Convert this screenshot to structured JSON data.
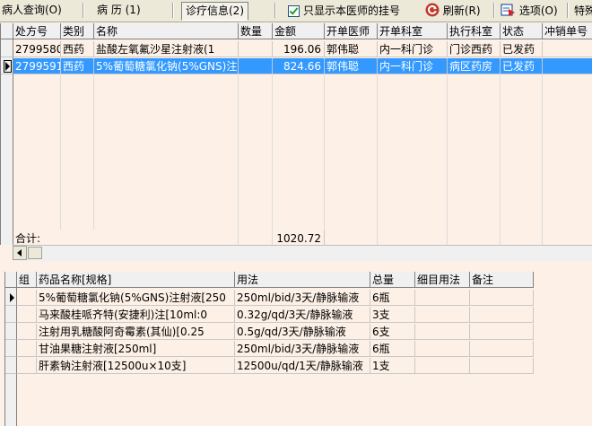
{
  "toolbar": {
    "tab_patient_query": "病人查询(O)",
    "tab_history": "病  历 (1)",
    "tab_diagnosis": "诊疗信息(2)",
    "checkbox_label": "只显示本医师的挂号",
    "checkbox_checked": true,
    "refresh_label": "刷新(R)",
    "options_label": "选项(O)",
    "special_label": "特殊"
  },
  "orders": {
    "columns": [
      "处方号",
      "类别",
      "名称",
      "数量",
      "金额",
      "开单医师",
      "开单科室",
      "执行科室",
      "状态",
      "冲销单号"
    ],
    "rows": [
      [
        "2799580",
        "西药",
        "盐酸左氧氟沙星注射液(1",
        "",
        "196.06",
        "郭伟聪",
        "内一科门诊",
        "门诊西药",
        "已发药",
        ""
      ],
      [
        "2799591",
        "西药",
        "5%葡萄糖氯化钠(5%GNS)注",
        "",
        "824.66",
        "郭伟聪",
        "内一科门诊",
        "病区药房",
        "已发药",
        ""
      ]
    ],
    "selected_row": 1,
    "total_label": "合计:",
    "total_value": "1020.72"
  },
  "details": {
    "columns": [
      "组",
      "药品名称[规格]",
      "用法",
      "总量",
      "细目用法",
      "备注"
    ],
    "rows": [
      [
        "",
        "5%葡萄糖氯化钠(5%GNS)注射液[250",
        "250ml/bid/3天/静脉输液",
        "6瓶",
        "",
        ""
      ],
      [
        "",
        "马来酸桂哌齐特(安捷利)注[10ml:0",
        "0.32g/qd/3天/静脉输液",
        "3支",
        "",
        ""
      ],
      [
        "",
        "注射用乳糖酸阿奇霉素(其仙)[0.25",
        "0.5g/qd/3天/静脉输液",
        "6支",
        "",
        ""
      ],
      [
        "",
        "甘油果糖注射液[250ml]",
        "250ml/bid/3天/静脉输液",
        "6瓶",
        "",
        ""
      ],
      [
        "",
        "肝素钠注射液[12500u×10支]",
        "12500u/qd/1天/静脉输液",
        "1支",
        "",
        ""
      ]
    ],
    "current_row": 0
  }
}
